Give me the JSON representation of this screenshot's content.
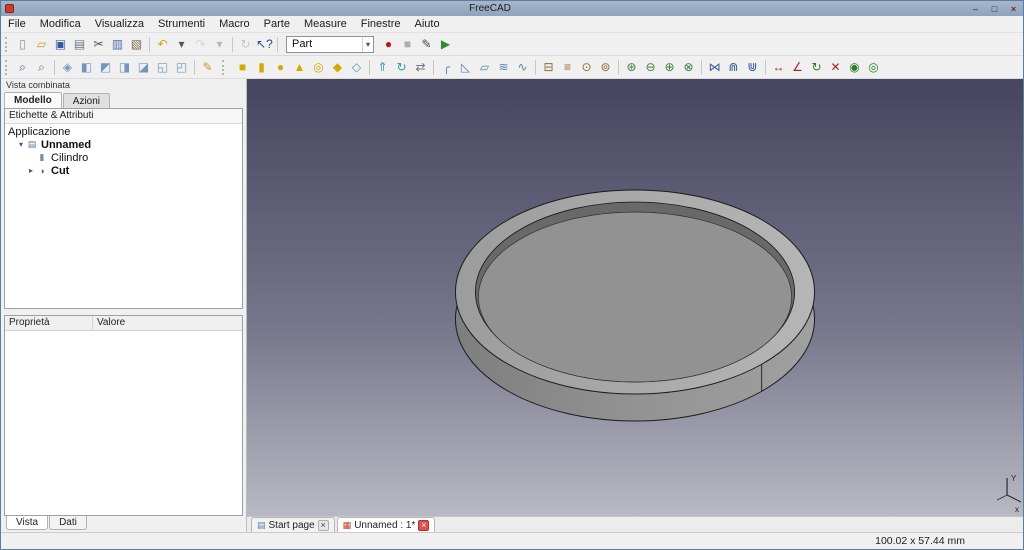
{
  "window": {
    "title": "FreeCAD",
    "icon_color": "#cf3b2a",
    "controls": {
      "minimize": "–",
      "maximize": "□",
      "close": "×"
    }
  },
  "menu": {
    "items": [
      "File",
      "Modifica",
      "Visualizza",
      "Strumenti",
      "Macro",
      "Parte",
      "Measure",
      "Finestre",
      "Aiuto"
    ]
  },
  "toolbar1": {
    "workbench": "Part",
    "workbench_arrow": "▾",
    "icons_left": [
      {
        "name": "new-file-icon",
        "glyph": "▯",
        "color": "#8a93a3"
      },
      {
        "name": "open-folder-icon",
        "glyph": "▱",
        "color": "#c9972b"
      },
      {
        "name": "save-icon",
        "glyph": "▣",
        "color": "#2f5d9e"
      },
      {
        "name": "print-icon",
        "glyph": "▤",
        "color": "#6f7680"
      },
      {
        "name": "cut-icon",
        "glyph": "✂",
        "color": "#4a4f57"
      },
      {
        "name": "copy-icon",
        "glyph": "▥",
        "color": "#4a6fa0"
      },
      {
        "name": "paste-icon",
        "glyph": "▧",
        "color": "#7d6a49"
      },
      {
        "type": "sep"
      },
      {
        "name": "undo-icon",
        "glyph": "↶",
        "color": "#d6a500"
      },
      {
        "name": "undo-arrow-icon",
        "glyph": "▾",
        "color": "#555555"
      },
      {
        "name": "redo-icon",
        "glyph": "↷",
        "color": "#d6a500",
        "disabled": true
      },
      {
        "name": "redo-arrow-icon",
        "glyph": "▾",
        "color": "#555555",
        "disabled": true
      },
      {
        "type": "sep"
      },
      {
        "name": "refresh-icon",
        "glyph": "↻",
        "color": "#3b7fb5",
        "disabled": true
      },
      {
        "name": "whats-this-icon",
        "glyph": "↖?",
        "color": "#2b4f86"
      },
      {
        "type": "sep"
      }
    ],
    "icons_right": [
      {
        "name": "macro-record-icon",
        "glyph": "●",
        "color": "#c01818"
      },
      {
        "name": "macro-stop-icon",
        "glyph": "■",
        "color": "#8c1d1d",
        "disabled": true
      },
      {
        "name": "macro-dialog-icon",
        "glyph": "✎",
        "color": "#3f4650"
      },
      {
        "name": "macro-execute-icon",
        "glyph": "▶",
        "color": "#2e8b2e"
      }
    ]
  },
  "toolbar2": {
    "icons": [
      {
        "name": "fit-all-icon",
        "glyph": "⌕",
        "color": "#335b8c"
      },
      {
        "name": "fit-selection-icon",
        "glyph": "⌕",
        "color": "#50779c"
      },
      {
        "type": "sep"
      },
      {
        "name": "view-axonometric-icon",
        "glyph": "◈",
        "color": "#7296bd"
      },
      {
        "name": "view-front-icon",
        "glyph": "◧",
        "color": "#7296bd"
      },
      {
        "name": "view-top-icon",
        "glyph": "◩",
        "color": "#7296bd"
      },
      {
        "name": "view-right-icon",
        "glyph": "◨",
        "color": "#7296bd"
      },
      {
        "name": "view-rear-icon",
        "glyph": "◪",
        "color": "#7296bd"
      },
      {
        "name": "view-bottom-icon",
        "glyph": "◱",
        "color": "#7296bd"
      },
      {
        "name": "view-left-icon",
        "glyph": "◰",
        "color": "#7296bd"
      },
      {
        "type": "sep"
      },
      {
        "name": "appearance-icon",
        "glyph": "✎",
        "color": "#c79a2a"
      },
      {
        "type": "gap"
      },
      {
        "name": "box-icon",
        "glyph": "■",
        "color": "#d8a800"
      },
      {
        "name": "cylinder-icon",
        "glyph": "▮",
        "color": "#d8a800"
      },
      {
        "name": "sphere-icon",
        "glyph": "●",
        "color": "#d8a800"
      },
      {
        "name": "cone-icon",
        "glyph": "▲",
        "color": "#d8a800"
      },
      {
        "name": "torus-icon",
        "glyph": "◎",
        "color": "#d8a800"
      },
      {
        "name": "create-primitives-icon",
        "glyph": "◆",
        "color": "#d8a800"
      },
      {
        "name": "shape-builder-icon",
        "glyph": "◇",
        "color": "#5b85ad"
      },
      {
        "type": "sep"
      },
      {
        "name": "extrude-icon",
        "glyph": "⇑",
        "color": "#2a9db0"
      },
      {
        "name": "revolve-icon",
        "glyph": "↻",
        "color": "#2a9db0"
      },
      {
        "name": "mirror-icon",
        "glyph": "⇄",
        "color": "#6a7a8a"
      },
      {
        "type": "sep"
      },
      {
        "name": "fillet-icon",
        "glyph": "╭",
        "color": "#5b85ad"
      },
      {
        "name": "chamfer-icon",
        "glyph": "◺",
        "color": "#5b85ad"
      },
      {
        "name": "ruled-surface-icon",
        "glyph": "▱",
        "color": "#5b85ad"
      },
      {
        "name": "loft-icon",
        "glyph": "≋",
        "color": "#5b85ad"
      },
      {
        "name": "sweep-icon",
        "glyph": "∿",
        "color": "#5b85ad"
      },
      {
        "type": "sep"
      },
      {
        "name": "section-icon",
        "glyph": "⊟",
        "color": "#8a6a3a"
      },
      {
        "name": "cross-sections-icon",
        "glyph": "≡",
        "color": "#8a6a3a"
      },
      {
        "name": "offset-icon",
        "glyph": "⊙",
        "color": "#8a6a3a"
      },
      {
        "name": "thickness-icon",
        "glyph": "⊚",
        "color": "#8a6a3a"
      },
      {
        "type": "sep"
      },
      {
        "name": "boolean-icon",
        "glyph": "⊛",
        "color": "#3a7a3a"
      },
      {
        "name": "cut-boolean-icon",
        "glyph": "⊖",
        "color": "#3a7a3a"
      },
      {
        "name": "union-icon",
        "glyph": "⊕",
        "color": "#3a7a3a"
      },
      {
        "name": "intersection-icon",
        "glyph": "⊗",
        "color": "#3a7a3a"
      },
      {
        "type": "sep"
      },
      {
        "name": "connect-icon",
        "glyph": "⋈",
        "color": "#3a5a9a"
      },
      {
        "name": "embed-icon",
        "glyph": "⋒",
        "color": "#3a5a9a"
      },
      {
        "name": "cutout-icon",
        "glyph": "⋓",
        "color": "#3a5a9a"
      },
      {
        "type": "sep"
      },
      {
        "name": "measure-linear-icon",
        "glyph": "↔",
        "color": "#b02020"
      },
      {
        "name": "measure-angular-icon",
        "glyph": "∠",
        "color": "#b02020"
      },
      {
        "name": "measure-refresh-icon",
        "glyph": "↻",
        "color": "#2a7a2a"
      },
      {
        "name": "measure-clear-icon",
        "glyph": "✕",
        "color": "#b02020"
      },
      {
        "name": "measure-toggle-all-icon",
        "glyph": "◉",
        "color": "#2a7a2a"
      },
      {
        "name": "measure-toggle-3d-icon",
        "glyph": "◎",
        "color": "#2a7a2a"
      }
    ]
  },
  "sidebar": {
    "dock_title": "Vista combinata",
    "tabs": [
      {
        "label": "Modello"
      },
      {
        "label": "Azioni"
      }
    ],
    "tree_header": "Etichette & Attributi",
    "tree": {
      "root": "Applicazione",
      "items": [
        {
          "expander": "▾",
          "icon": "▤",
          "label": "Unnamed"
        },
        {
          "expander": "",
          "icon": "▮",
          "label": "Cilindro"
        },
        {
          "expander": "▸",
          "icon": "◑",
          "label": "Cut"
        }
      ]
    },
    "properties": {
      "name_header": "Proprietà",
      "value_header": "Valore"
    },
    "bottom_tabs": [
      {
        "label": "Vista"
      },
      {
        "label": "Dati"
      }
    ]
  },
  "viewport": {
    "background_top": "#45455f",
    "background_mid": "#74748a",
    "background_bottom": "#b9b9c3",
    "model": {
      "face": "#929292",
      "rim_left": "#9c9c9c",
      "rim_right": "#b6b6b6",
      "side_dark": "#7e7e7e",
      "side_mid": "#939393",
      "side_light": "#a0a0a0",
      "cavity": "#696969",
      "outline": "#1b1b1b"
    },
    "tabs": [
      {
        "icon": "▤",
        "label": "Start page",
        "close": "×"
      },
      {
        "icon": "▦",
        "label": "Unnamed : 1*",
        "close": "×"
      }
    ],
    "axes": {
      "x_label": "x",
      "y_label": "Y"
    }
  },
  "statusbar": {
    "dimensions": "100.02 x 57.44 mm"
  }
}
